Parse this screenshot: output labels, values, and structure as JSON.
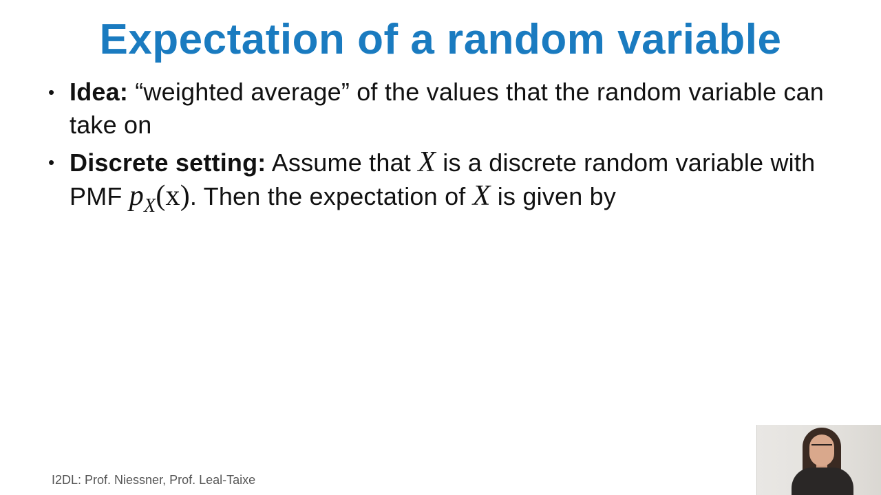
{
  "slide": {
    "title": "Expectation of a random variable",
    "bullets": [
      {
        "marker": "•",
        "keyword": "Idea:",
        "text": " “weighted average” of the values that the random variable can take on"
      },
      {
        "marker": "•",
        "keyword": "Discrete setting:",
        "text_1": " Assume that ",
        "math_1": "X",
        "text_2": " is a discrete random variable with PMF ",
        "math_p": "p",
        "math_sub": "X",
        "math_arg": "(x)",
        "text_3": ". Then the expectation of ",
        "math_2": "X",
        "text_4": " is given by"
      }
    ],
    "footer": "I2DL: Prof. Niessner, Prof. Leal-Taixe",
    "title_color": "#1a7bc0"
  }
}
